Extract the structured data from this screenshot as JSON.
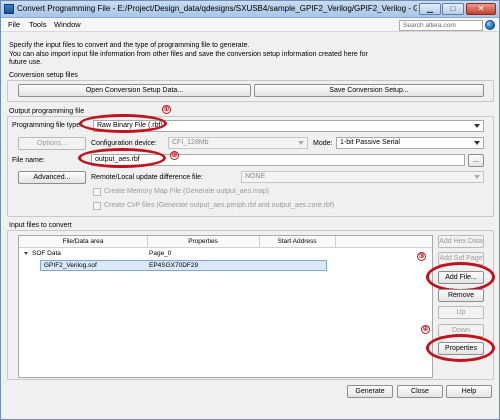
{
  "window": {
    "title": "Convert Programming File - E:/Project/Design_data/qdesigns/SXUSB4/sample_GPIF2_Verilog/GPIF2_Verilog - GPI...",
    "min_label": "▁",
    "max_label": "□",
    "close_label": "✕"
  },
  "menu": {
    "file": "File",
    "tools": "Tools",
    "window": "Window"
  },
  "search": {
    "placeholder": "Search altera.com"
  },
  "intro": {
    "line1": "Specify the input files to convert and the type of programming file to generate.",
    "line2": "You can also import input file information from other files and save the conversion setup information created here for",
    "line3": "future use."
  },
  "conversion_setup": {
    "title": "Conversion setup files",
    "open_button": "Open Conversion Setup Data...",
    "save_button": "Save Conversion Setup..."
  },
  "output": {
    "title": "Output programming file",
    "type_label": "Programming file type:",
    "type_value": "Raw Binary File (.rbf)",
    "options_button": "Options...",
    "config_device_label": "Configuration device:",
    "config_device_value": "CFI_128Mb",
    "mode_label": "Mode:",
    "mode_value": "1-bit Passive Serial",
    "file_name_label": "File name:",
    "file_name_value": "output_aes.rbf",
    "browse_button": "...",
    "advanced_button": "Advanced...",
    "remote_label": "Remote/Local update difference file:",
    "remote_value": "NONE",
    "memory_map_label": "Create Memory Map File (Generate output_aes.map)",
    "cvp_label": "Create CvP files (Generate output_aes.periph.rbf and output_aes.core.rbf)"
  },
  "input": {
    "title": "Input files to convert",
    "columns": [
      "File/Data area",
      "Properties",
      "Start Address"
    ],
    "rows": [
      {
        "name": "SOF Data",
        "properties": "Page_0",
        "start": ""
      },
      {
        "name": "GPIF2_Verilog.sof",
        "properties": "EP4SGX70DF29",
        "start": ""
      }
    ],
    "buttons": {
      "add_hex": "Add Hex Data",
      "add_sof_page": "Add Sof Page",
      "add_file": "Add File...",
      "remove": "Remove",
      "up": "Up",
      "down": "Down",
      "properties": "Properties"
    }
  },
  "annotations": [
    "①",
    "②",
    "③",
    "④"
  ],
  "footer": {
    "generate": "Generate",
    "close": "Close",
    "help": "Help"
  },
  "colors": {
    "highlight": "#c0141c",
    "selection": "#dbe8fa"
  }
}
